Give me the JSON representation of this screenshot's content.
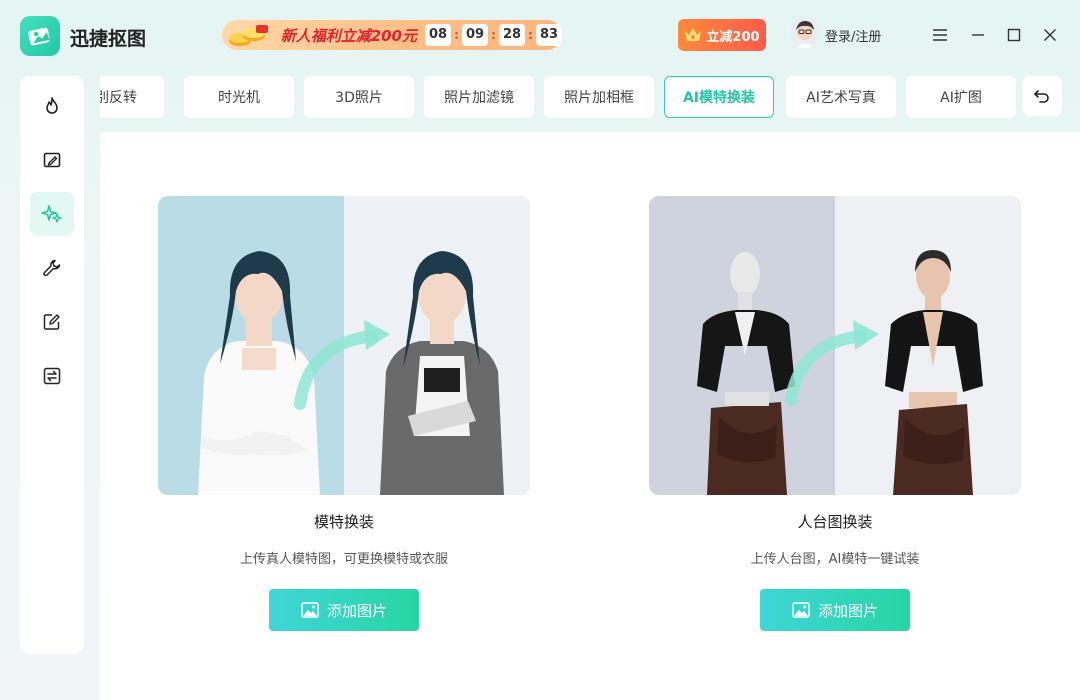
{
  "app": {
    "name": "迅捷抠图"
  },
  "promo": {
    "text": "新人福利立减200元",
    "timer": [
      "08",
      "09",
      "28",
      "83"
    ]
  },
  "vip": {
    "label": "立减200"
  },
  "user": {
    "login_label": "登录/注册"
  },
  "tabs": [
    {
      "label": "性别反转",
      "active": false
    },
    {
      "label": "时光机",
      "active": false
    },
    {
      "label": "3D照片",
      "active": false
    },
    {
      "label": "照片加滤镜",
      "active": false
    },
    {
      "label": "照片加相框",
      "active": false
    },
    {
      "label": "AI模特换装",
      "active": true
    },
    {
      "label": "AI艺术写真",
      "active": false
    },
    {
      "label": "AI扩图",
      "active": false
    }
  ],
  "sidebar": {
    "items": [
      {
        "icon": "flame-icon",
        "active": false
      },
      {
        "icon": "image-edit-icon",
        "active": false
      },
      {
        "icon": "sparkle-icon",
        "active": true
      },
      {
        "icon": "wrench-icon",
        "active": false
      },
      {
        "icon": "pencil-edit-icon",
        "active": false
      },
      {
        "icon": "convert-icon",
        "active": false
      }
    ]
  },
  "cards": [
    {
      "title": "模特换装",
      "desc": "上传真人模特图，可更换模特或衣服",
      "button": "添加图片"
    },
    {
      "title": "人台图换装",
      "desc": "上传人台图，AI模特一键试装",
      "button": "添加图片"
    }
  ],
  "colors": {
    "accent": "#22c6a2",
    "promo_red": "#e3232c",
    "vip_orange": "#ff6b3d"
  }
}
